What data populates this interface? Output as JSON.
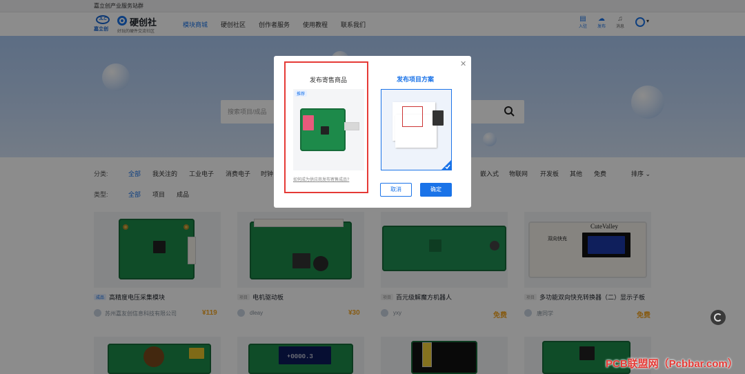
{
  "topbar": {
    "text": "嘉立创产业服务站群"
  },
  "header": {
    "logo_lc": "嘉立创",
    "logo_lc_badge": "JLC",
    "brand_name": "硬创社",
    "brand_slogan": "好玩的硬件交流社区",
    "nav": [
      "模块商城",
      "硬创社区",
      "创作者服务",
      "使用教程",
      "联系我们"
    ],
    "actions": [
      "入驻",
      "发布",
      "消息"
    ]
  },
  "search": {
    "placeholder": "搜索项目/成品"
  },
  "filters": {
    "category_label": "分类:",
    "categories": [
      "全部",
      "我关注的",
      "工业电子",
      "消费电子",
      "时钟",
      "嵌入式",
      "物联网",
      "开发板",
      "其他",
      "免费"
    ],
    "sort_label": "排序",
    "type_label": "类型:",
    "types": [
      "全部",
      "项目",
      "成品"
    ]
  },
  "products": [
    {
      "tag": "成品",
      "title": "高精度电压采集模块",
      "author": "苏州嘉友创信息科技有限公司",
      "price": "¥119"
    },
    {
      "tag": "项目",
      "title": "电机驱动板",
      "author": "dleay",
      "price": "¥30"
    },
    {
      "tag": "项目",
      "title": "百元级解魔方机器人",
      "author": "yxy",
      "price": "免费"
    },
    {
      "tag": "项目",
      "title": "多功能双向快充转换器（二）显示子板",
      "author": "唐同学",
      "price": "免费"
    }
  ],
  "card_texts": {
    "cutevalley": "CuteValley",
    "quick_charge": "双向快充",
    "display_value": "+0000.3"
  },
  "modal": {
    "option_sell": {
      "title": "发布寄售商品",
      "badge": "推荐",
      "hint": "如何成为供应商发布寄售成品?"
    },
    "option_project": {
      "title": "发布项目方案"
    },
    "cancel": "取消",
    "confirm": "确定"
  },
  "watermark": "PCB联盟网（Pcbbar.com）",
  "colors": {
    "accent": "#1a73e8",
    "price": "#f5a623",
    "highlight": "#e53935"
  }
}
